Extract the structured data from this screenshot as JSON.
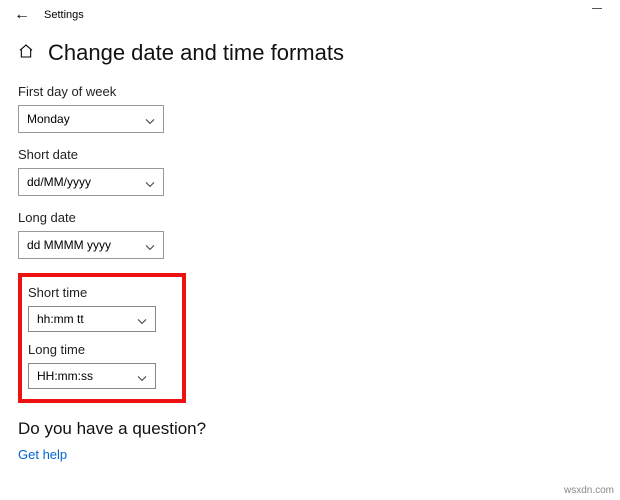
{
  "window": {
    "title": "Settings"
  },
  "header": {
    "title": "Change date and time formats"
  },
  "fields": {
    "firstDayOfWeek": {
      "label": "First day of week",
      "value": "Monday"
    },
    "shortDate": {
      "label": "Short date",
      "value": "dd/MM/yyyy"
    },
    "longDate": {
      "label": "Long date",
      "value": "dd MMMM yyyy"
    },
    "shortTime": {
      "label": "Short time",
      "value": "hh:mm tt"
    },
    "longTime": {
      "label": "Long time",
      "value": "HH:mm:ss"
    }
  },
  "question": {
    "heading": "Do you have a question?",
    "link": "Get help"
  },
  "watermark": "wsxdn.com"
}
